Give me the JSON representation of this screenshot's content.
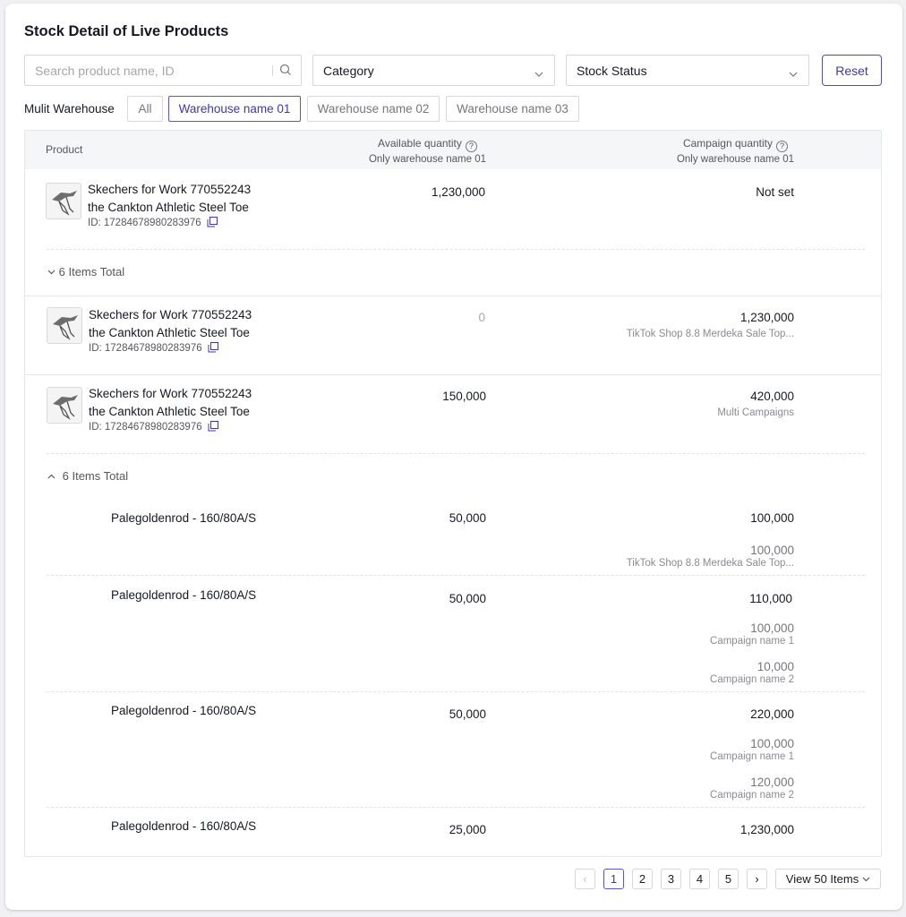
{
  "page": {
    "title": "Stock Detail of Live Products"
  },
  "filters": {
    "search_placeholder": "Search product name, ID",
    "category": "Category",
    "stock_status": "Stock Status",
    "reset": "Reset"
  },
  "warehouse": {
    "label": "Mulit Warehouse",
    "options": [
      "All",
      "Warehouse name 01",
      "Warehouse name 02",
      "Warehouse name 03"
    ],
    "selected": "Warehouse name 01"
  },
  "table": {
    "columns": {
      "product": "Product",
      "available": "Available quantity",
      "available_sub": "Only warehouse name 01",
      "campaign": "Campaign quantity",
      "campaign_sub": "Only warehouse name 01"
    },
    "rows": [
      {
        "name1": "Skechers for Work 770552243",
        "name2": "the Cankton Athletic Steel Toe",
        "id": "ID: 17284678980283976",
        "available": "1,230,000",
        "campaign": "Not set",
        "campaign_sub": ""
      },
      {
        "name1": "Skechers for Work 770552243",
        "name2": "the Cankton Athletic Steel Toe",
        "id": "ID: 17284678980283976",
        "available": "0",
        "campaign": "1,230,000",
        "campaign_sub": "TikTok Shop 8.8 Merdeka Sale Top..."
      },
      {
        "name1": "Skechers for Work 770552243",
        "name2": "the Cankton Athletic Steel Toe",
        "id": "ID: 17284678980283976",
        "available": "150,000",
        "campaign": "420,000",
        "campaign_sub": "Multi Campaigns"
      }
    ],
    "expander1": "6 Items Total",
    "expander2": "6 Items Total",
    "variants": [
      {
        "name": "Palegoldenrod - 160/80A/S",
        "available": "50,000",
        "campaign": "100,000",
        "breakdown": [
          {
            "value": "100,000",
            "label": "TikTok Shop 8.8 Merdeka Sale Top..."
          }
        ]
      },
      {
        "name": "Palegoldenrod - 160/80A/S",
        "available": "50,000",
        "campaign": "110,000",
        "breakdown": [
          {
            "value": "100,000",
            "label": "Campaign name 1"
          },
          {
            "value": "10,000",
            "label": "Campaign name 2"
          }
        ]
      },
      {
        "name": "Palegoldenrod - 160/80A/S",
        "available": "50,000",
        "campaign": "220,000",
        "breakdown": [
          {
            "value": "100,000",
            "label": "Campaign name 1"
          },
          {
            "value": "120,000",
            "label": "Campaign name 2"
          }
        ]
      },
      {
        "name": "Palegoldenrod - 160/80A/S",
        "available": "25,000",
        "campaign": "1,230,000",
        "breakdown": []
      }
    ]
  },
  "pagination": {
    "pages": [
      "1",
      "2",
      "3",
      "4",
      "5"
    ],
    "current": "1",
    "prev": "‹",
    "next": "›",
    "view_label": "View 50 Items"
  },
  "colors": {
    "accent": "#3e37b0",
    "border": "#d6d7da",
    "header_bg": "#f5f6f8"
  },
  "icons": {
    "search": "search-icon",
    "chevron": "chevron-down-icon",
    "copy": "copy-icon",
    "help": "help-circle-icon"
  }
}
